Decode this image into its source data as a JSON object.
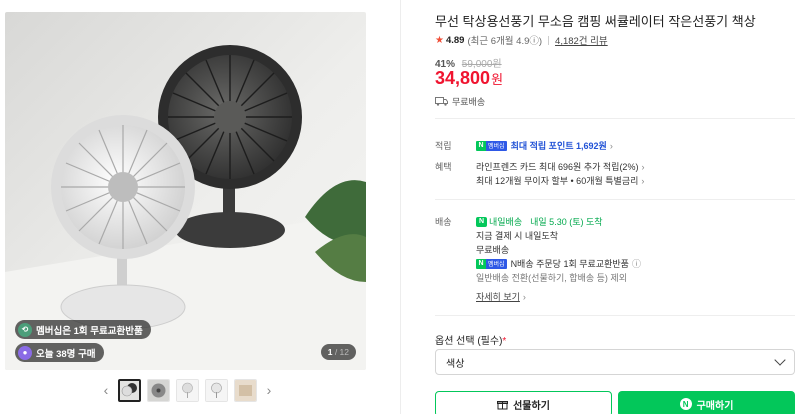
{
  "gallery": {
    "badges": [
      {
        "text": "멤버십은 1회 무료교환반품"
      },
      {
        "text": "오늘 38명 구매"
      }
    ],
    "counter": {
      "current": "1",
      "total": "/ 12"
    },
    "prev_label": "‹",
    "next_label": "›"
  },
  "product": {
    "title": "무선 탁상용선풍기 무소음 캠핑 써큘레이터 작은선풍기 책상",
    "rating_score": "4.89",
    "rating_recent": "(최근 6개월 4.9ⓘ)",
    "review_count": "4,182건 리뷰",
    "discount_pct": "41%",
    "original_price": "59,000원",
    "price": "34,800",
    "price_unit": "원",
    "shipping_free": "무료배송"
  },
  "details": {
    "points_label": "적립",
    "points_value": "최대 적립 포인트 1,692원",
    "benefit_label": "혜택",
    "benefit_line1": "라인프렌즈 카드 최대 696원 추가 적립(2%)",
    "benefit_line2": "최대 12개월 무이자 할부 • 60개월 특별금리",
    "delivery_label": "배송",
    "delivery_tag": "내일배송",
    "delivery_date": "내일 5.30 (토) 도착",
    "delivery_line2": "지금 결제 시 내일도착",
    "delivery_line3": "무료배송",
    "delivery_line4": "N배송 주문당 1회 무료교환반품",
    "delivery_line5": "일반배송 전환(선물하기, 합배송 등) 제외",
    "more_link": "자세히 보기",
    "npay_n": "N",
    "npay_m": "멤버십"
  },
  "options": {
    "label": "옵션 선택 (필수)",
    "required_mark": "*",
    "selected": "색상"
  },
  "actions": {
    "gift": "선물하기",
    "buy": "구매하기"
  },
  "colors": {
    "accent_green": "#03c75a",
    "price_red": "#f0142f",
    "point_blue": "#2152d6"
  }
}
